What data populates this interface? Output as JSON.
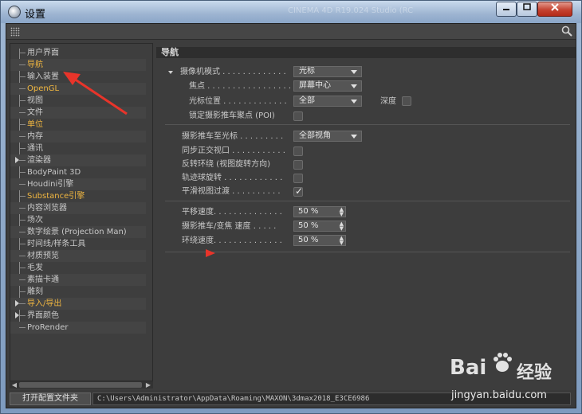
{
  "window": {
    "title": "设置",
    "background_title_text": "CINEMA 4D R19.024 Studio (RC"
  },
  "tree": {
    "items": [
      {
        "label": "用户界面",
        "highlight": false,
        "expandable": false
      },
      {
        "label": "导航",
        "highlight": true,
        "expandable": false
      },
      {
        "label": "输入装置",
        "highlight": false,
        "expandable": false
      },
      {
        "label": "OpenGL",
        "highlight": true,
        "expandable": false
      },
      {
        "label": "视图",
        "highlight": false,
        "expandable": false
      },
      {
        "label": "文件",
        "highlight": false,
        "expandable": false
      },
      {
        "label": "单位",
        "highlight": true,
        "expandable": false
      },
      {
        "label": "内存",
        "highlight": false,
        "expandable": false
      },
      {
        "label": "通讯",
        "highlight": false,
        "expandable": false
      },
      {
        "label": "渲染器",
        "highlight": false,
        "expandable": true
      },
      {
        "label": "BodyPaint 3D",
        "highlight": false,
        "expandable": false
      },
      {
        "label": "Houdini引擎",
        "highlight": false,
        "expandable": false
      },
      {
        "label": "Substance引擎",
        "highlight": true,
        "expandable": false
      },
      {
        "label": "内容浏览器",
        "highlight": false,
        "expandable": false
      },
      {
        "label": "场次",
        "highlight": false,
        "expandable": false
      },
      {
        "label": "数字绘景 (Projection Man)",
        "highlight": false,
        "expandable": false
      },
      {
        "label": "时间线/样条工具",
        "highlight": false,
        "expandable": false
      },
      {
        "label": "材质预览",
        "highlight": false,
        "expandable": false
      },
      {
        "label": "毛发",
        "highlight": false,
        "expandable": false
      },
      {
        "label": "素描卡通",
        "highlight": false,
        "expandable": false
      },
      {
        "label": "雕刻",
        "highlight": false,
        "expandable": false
      },
      {
        "label": "导入/导出",
        "highlight": true,
        "expandable": true
      },
      {
        "label": "界面颜色",
        "highlight": false,
        "expandable": true
      },
      {
        "label": "ProRender",
        "highlight": false,
        "expandable": false
      }
    ]
  },
  "panel": {
    "header": "导航",
    "camera_mode": {
      "label": "摄像机模式 . . . . . . . . . . . . .",
      "value": "光标"
    },
    "focus": {
      "label": "焦点 . . . . . . . . . . . . . . . . .",
      "value": "屏幕中心"
    },
    "cursor_position": {
      "label": "光标位置 . . . . . . . . . . . . .",
      "value": "全部"
    },
    "depth": {
      "label": "深度",
      "checked": false
    },
    "lock_dolly": {
      "label": "锁定摄影推车聚点 (POI)",
      "checked": false
    },
    "dolly_to_cursor": {
      "label": "摄影推车至光标 . . . . . . . . .",
      "value": "全部视角"
    },
    "sync_ortho": {
      "label": "同步正交视口 . . . . . . . . . . .",
      "checked": false
    },
    "invert_orbit": {
      "label": "反转环绕 (视图旋转方向)",
      "checked": false
    },
    "trackball": {
      "label": "轨迹球旋转 . . . . . . . . . . . .",
      "checked": false
    },
    "smooth_transition": {
      "label": "平滑视图过渡 . . . . . . . . . .",
      "checked": true
    },
    "pan_speed": {
      "label": "平移速度. . . . . . . . . . . . . .",
      "value": "50 %"
    },
    "dolly_speed": {
      "label": "摄影推车/变焦 速度 . . . . .",
      "value": "50 %"
    },
    "orbit_speed": {
      "label": "环绕速度. . . . . . . . . . . . . .",
      "value": "50 %"
    }
  },
  "bottom": {
    "open_config_label": "打开配置文件夹",
    "path": "C:\\Users\\Administrator\\AppData\\Roaming\\MAXON\\3dmax2018_E3CE6986"
  },
  "watermark": {
    "logo": "Bai",
    "logo_suffix": "经验",
    "site": "jingyan.baidu.com"
  },
  "colors": {
    "highlight_text": "#f0b640",
    "annotation_red": "#e8342a"
  }
}
